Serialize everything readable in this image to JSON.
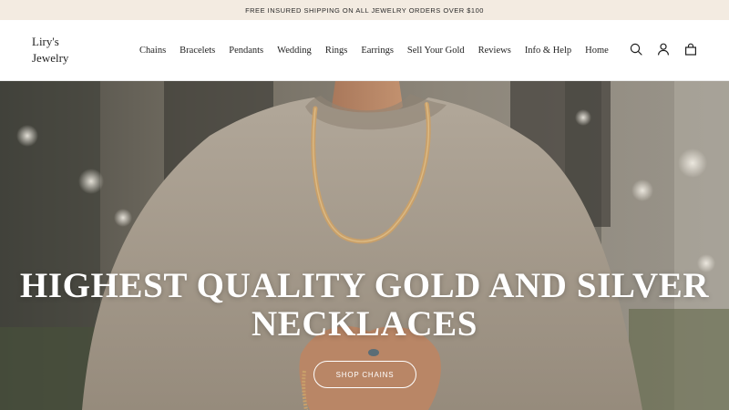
{
  "announcement": {
    "text": "FREE INSURED SHIPPING ON ALL JEWELRY ORDERS OVER $100"
  },
  "header": {
    "logo_line1": "Liry's",
    "logo_line2": "Jewelry",
    "nav": [
      "Chains",
      "Bracelets",
      "Pendants",
      "Wedding",
      "Rings",
      "Earrings",
      "Sell Your Gold",
      "Reviews",
      "Info & Help",
      "Home"
    ],
    "icons": [
      "search-icon",
      "account-icon",
      "cart-bag-icon"
    ]
  },
  "hero": {
    "title_line1": "HIGHEST QUALITY GOLD AND SILVER",
    "title_line2": "NECKLACES",
    "cta_label": "SHOP CHAINS"
  },
  "colors": {
    "announcement_bg": "#f3ebe1",
    "text_dark": "#1f1f1f",
    "hero_text": "#ffffff",
    "sweater": "#a59a8c",
    "gold_chain": "#c9a06a"
  }
}
